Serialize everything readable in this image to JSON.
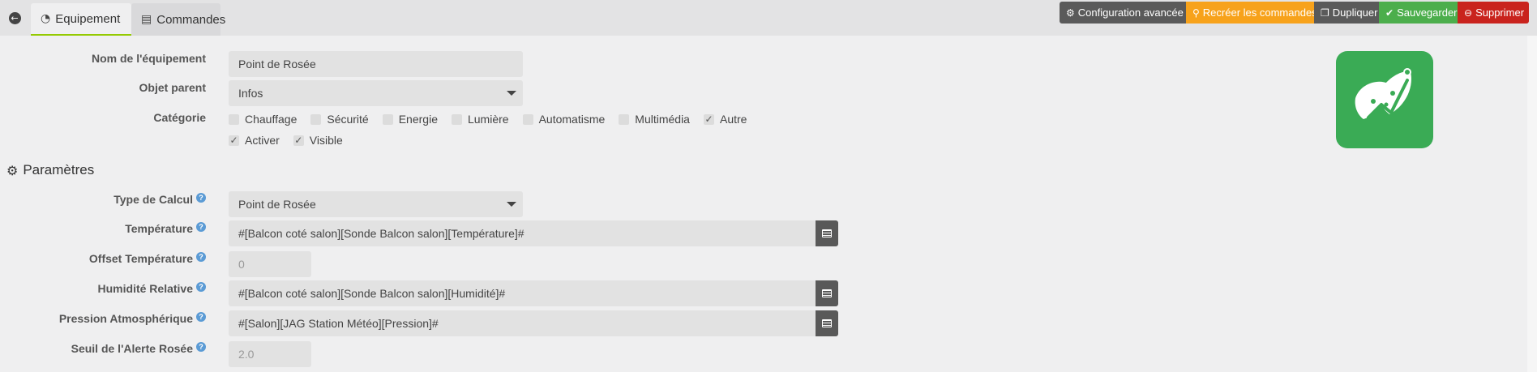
{
  "tabs": {
    "equipement": "Equipement",
    "commandes": "Commandes"
  },
  "actions": {
    "config": "Configuration avancée",
    "recreate": "Recréer les commandes",
    "duplicate": "Dupliquer",
    "save": "Sauvegarder",
    "delete": "Supprimer"
  },
  "colors": {
    "recreate": "#f7a21b",
    "save": "#4cae4c",
    "delete": "#c9231d",
    "dark": "#5a5a5a",
    "logo": "#3aab55"
  },
  "equipment": {
    "name_label": "Nom de l'équipement",
    "name_value": "Point de Rosée",
    "parent_label": "Objet parent",
    "parent_value": "Infos",
    "category_label": "Catégorie",
    "categories": [
      {
        "label": "Chauffage",
        "checked": false
      },
      {
        "label": "Sécurité",
        "checked": false
      },
      {
        "label": "Energie",
        "checked": false
      },
      {
        "label": "Lumière",
        "checked": false
      },
      {
        "label": "Automatisme",
        "checked": false
      },
      {
        "label": "Multimédia",
        "checked": false
      },
      {
        "label": "Autre",
        "checked": true
      }
    ],
    "activate_label": "Activer",
    "visible_label": "Visible"
  },
  "params": {
    "title": "Paramètres",
    "calc_type_label": "Type de Calcul",
    "calc_type_value": "Point de Rosée",
    "temp_label": "Température",
    "temp_value": "#[Balcon coté salon][Sonde Balcon salon][Température]#",
    "offset_label": "Offset Température",
    "offset_placeholder": "0",
    "humidity_label": "Humidité Relative",
    "humidity_value": "#[Balcon coté salon][Sonde Balcon salon][Humidité]#",
    "pressure_label": "Pression Atmosphérique",
    "pressure_value": "#[Salon][JAG Station Météo][Pression]#",
    "threshold_label": "Seuil de l'Alerte Rosée",
    "threshold_placeholder": "2.0"
  }
}
